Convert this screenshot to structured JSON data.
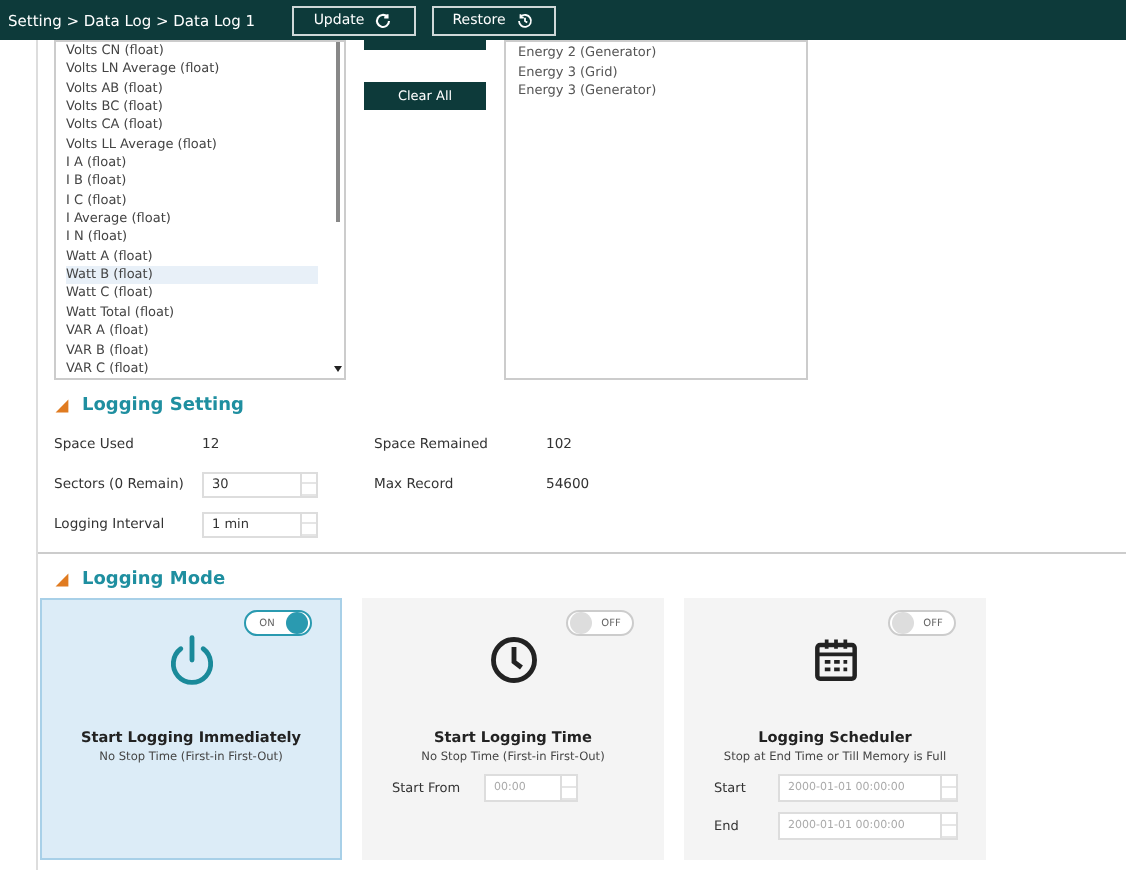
{
  "header": {
    "breadcrumb": "Setting > Data Log > Data Log 1",
    "buttons": [
      {
        "label": "Update",
        "kind": "update"
      },
      {
        "label": "Restore",
        "kind": "restore"
      }
    ]
  },
  "available_list": {
    "items": [
      {
        "label": "Volts CN (float)",
        "selected": false
      },
      {
        "label": "Volts LN Average (float)",
        "selected": false
      },
      {
        "label": "Volts AB (float)",
        "selected": false
      },
      {
        "label": "Volts BC (float)",
        "selected": false
      },
      {
        "label": "Volts CA (float)",
        "selected": false
      },
      {
        "label": "Volts LL Average (float)",
        "selected": false
      },
      {
        "label": "I A (float)",
        "selected": false
      },
      {
        "label": "I B (float)",
        "selected": false
      },
      {
        "label": "I C (float)",
        "selected": false
      },
      {
        "label": "I Average (float)",
        "selected": false
      },
      {
        "label": "I N (float)",
        "selected": false
      },
      {
        "label": "Watt A (float)",
        "selected": false
      },
      {
        "label": "Watt B (float)",
        "selected": true
      },
      {
        "label": "Watt C (float)",
        "selected": false
      },
      {
        "label": "Watt Total (float)",
        "selected": false
      },
      {
        "label": "VAR A (float)",
        "selected": false
      },
      {
        "label": "VAR B (float)",
        "selected": false
      },
      {
        "label": "VAR C (float)",
        "selected": false
      }
    ]
  },
  "middle_buttons": [
    {
      "kind": "stub"
    },
    {
      "kind": "clear",
      "label": "Clear All"
    }
  ],
  "selected_list": {
    "items": [
      "Energy 2 (Generator)",
      "Energy 3 (Grid)",
      "Energy 3 (Generator)"
    ]
  },
  "logging_setting": {
    "title": "Logging Setting",
    "rows": [
      {
        "label": "Space Used",
        "value": "12",
        "kind": "text",
        "label2": "Space Remained",
        "value2": "102"
      },
      {
        "label": "Sectors (0 Remain)",
        "value": "30",
        "kind": "spinner",
        "label2": "Max Record",
        "value2": "54600"
      },
      {
        "label": "Logging Interval",
        "value": "1 min",
        "kind": "spinner"
      }
    ]
  },
  "logging_mode": {
    "title": "Logging Mode",
    "cards": [
      {
        "kind": "immediate",
        "selected": true,
        "toggle": {
          "on": true,
          "label": "ON"
        },
        "title": "Start Logging Immediately",
        "subtitle": "No Stop Time (First-in First-Out)"
      },
      {
        "kind": "time",
        "selected": false,
        "toggle": {
          "on": false,
          "label": "OFF"
        },
        "title": "Start Logging Time",
        "subtitle": "No Stop Time (First-in First-Out)",
        "fields": [
          {
            "label": "Start From",
            "value": "00:00"
          }
        ]
      },
      {
        "kind": "scheduler",
        "selected": false,
        "toggle": {
          "on": false,
          "label": "OFF"
        },
        "title": "Logging Scheduler",
        "subtitle": "Stop at End Time or Till Memory is Full",
        "fields": [
          {
            "label": "Start",
            "value": "2000-01-01 00:00:00"
          },
          {
            "label": "End",
            "value": "2000-01-01 00:00:00"
          }
        ]
      }
    ]
  }
}
